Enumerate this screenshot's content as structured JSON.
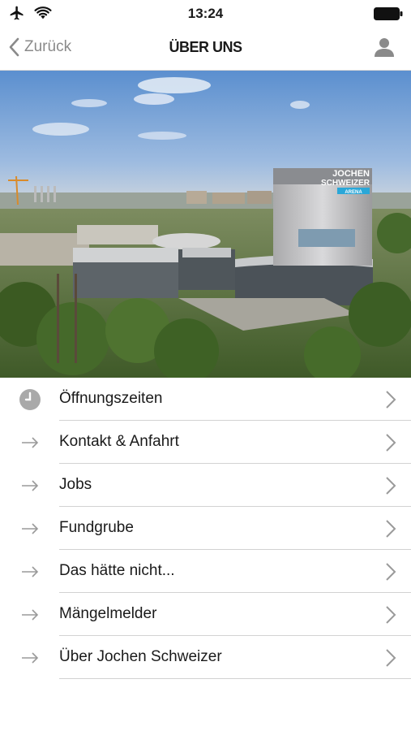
{
  "status": {
    "time": "13:24"
  },
  "nav": {
    "back_label": "Zurück",
    "title": "ÜBER UNS"
  },
  "hero": {
    "sign_line1": "JOCHEN",
    "sign_line2": "SCHWEIZER",
    "sign_line3": "ARENA"
  },
  "menu": {
    "items": [
      {
        "label": "Öffnungszeiten",
        "icon": "clock-icon"
      },
      {
        "label": "Kontakt & Anfahrt",
        "icon": "arrow-right-icon"
      },
      {
        "label": "Jobs",
        "icon": "arrow-right-icon"
      },
      {
        "label": "Fundgrube",
        "icon": "arrow-right-icon"
      },
      {
        "label": "Das hätte nicht...",
        "icon": "arrow-right-icon"
      },
      {
        "label": "Mängelmelder",
        "icon": "arrow-right-icon"
      },
      {
        "label": "Über Jochen Schweizer",
        "icon": "arrow-right-icon"
      }
    ]
  },
  "colors": {
    "accent_gray": "#8a8a8a",
    "separator": "#d2d2d2"
  }
}
